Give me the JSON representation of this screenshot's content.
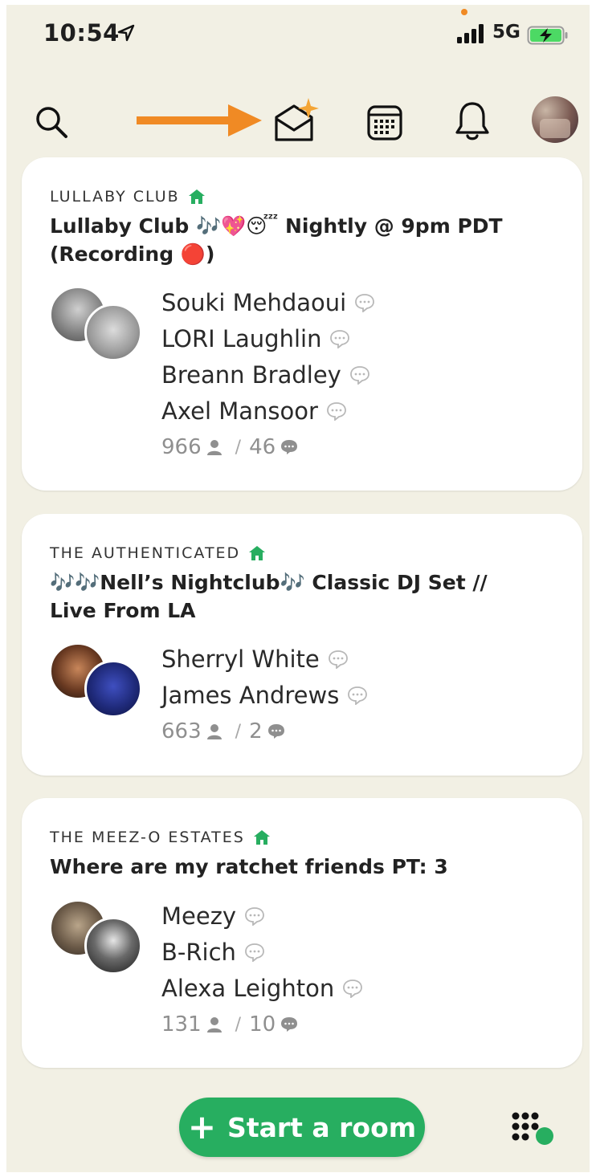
{
  "status_bar": {
    "time": "10:54",
    "network": "5G"
  },
  "colors": {
    "accent_green": "#27ae60",
    "background": "#f2f0e4",
    "arrow_orange": "#f08a24"
  },
  "toolbar": {
    "icons": [
      "search-icon",
      "invite-envelope-icon",
      "calendar-icon",
      "bell-icon",
      "profile-avatar"
    ]
  },
  "rooms": [
    {
      "club": "LULLABY CLUB",
      "title": "Lullaby Club 🎶💖😴 Nightly @ 9pm PDT (Recording 🔴)",
      "speakers": [
        "Souki Mehdaoui",
        "LORI Laughlin",
        "Breann Bradley",
        "Axel Mansoor"
      ],
      "listeners": "966",
      "speakers_count": "46"
    },
    {
      "club": "THE AUTHENTICATED",
      "title": "🎶🎶Nell’s Nightclub🎶 Classic DJ Set // Live From LA",
      "speakers": [
        "Sherryl White",
        "James Andrews"
      ],
      "listeners": "663",
      "speakers_count": "2"
    },
    {
      "club": "THE MEEZ-O ESTATES",
      "title": "Where are my ratchet friends PT: 3",
      "speakers": [
        "Meezy",
        "B-Rich",
        "Alexa Leighton"
      ],
      "listeners": "131",
      "speakers_count": "10"
    }
  ],
  "start_room": {
    "plus": "+",
    "label": "Start a room"
  }
}
